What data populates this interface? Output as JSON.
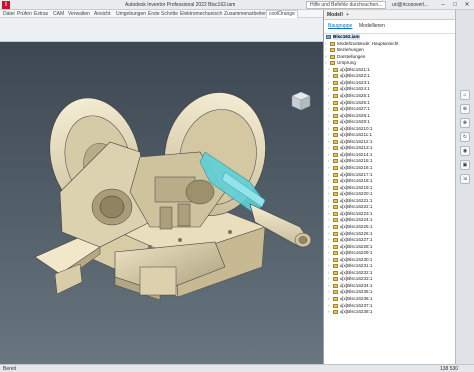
{
  "window": {
    "title": "Autodesk Inventor Professional 2022   Blsc162.iam",
    "help_search": "Hilfe und Befehle durchsuchen...",
    "user": "uri@ricosoverl...",
    "controls": {
      "minimize": "–",
      "maximize": "□",
      "close": "✕"
    }
  },
  "ribbon": {
    "tabs": [
      "Datei",
      "Prüfen",
      "Extras",
      "CAM",
      "Verwalten",
      "Ansicht",
      "Umgebungen",
      "Erste Schritte",
      "Elektromechanisch",
      "Zusammenarbeiten",
      "coolOrange"
    ],
    "active_tab": "coolOrange"
  },
  "browser": {
    "tabs": [
      "Modell",
      "+"
    ],
    "toolbar_primary": "Baugruppe",
    "toolbar_secondary": "Modellieren",
    "tree": [
      {
        "label": "Blsc162.iam",
        "type": "assembly",
        "selected": true
      },
      {
        "label": "Modellzustände: Hauptansicht",
        "type": "folder"
      },
      {
        "label": "Beziehungen",
        "type": "folder"
      },
      {
        "label": "Darstellungen",
        "type": "folder"
      },
      {
        "label": "Ursprung",
        "type": "folder"
      },
      {
        "label": "ᴀ[x]Blsc1621:1",
        "type": "part"
      },
      {
        "label": "ᴀ[x]Blsc1622:1",
        "type": "part"
      },
      {
        "label": "ᴀ[x]Blsc1623:1",
        "type": "part"
      },
      {
        "label": "ᴀ[x]Blsc1624:1",
        "type": "part"
      },
      {
        "label": "ᴀ[x]Blsc1625:1",
        "type": "part"
      },
      {
        "label": "ᴀ[x]Blsc1626:1",
        "type": "part"
      },
      {
        "label": "ᴀ[x]Blsc1627:1",
        "type": "part"
      },
      {
        "label": "ᴀ[x]Blsc1628:1",
        "type": "part"
      },
      {
        "label": "ᴀ[x]Blsc1629:1",
        "type": "part"
      },
      {
        "label": "ᴀ[x]Blsc16210:1",
        "type": "part"
      },
      {
        "label": "ᴀ[x]Blsc16211:1",
        "type": "part"
      },
      {
        "label": "ᴀ[x]Blsc16212:1",
        "type": "part"
      },
      {
        "label": "ᴀ[x]Blsc16213:1",
        "type": "part"
      },
      {
        "label": "ᴀ[x]Blsc16214:1",
        "type": "part"
      },
      {
        "label": "ᴀ[x]Blsc16215:1",
        "type": "part"
      },
      {
        "label": "ᴀ[x]Blsc16216:1",
        "type": "part"
      },
      {
        "label": "ᴀ[x]Blsc16217:1",
        "type": "part"
      },
      {
        "label": "ᴀ[x]Blsc16218:1",
        "type": "part"
      },
      {
        "label": "ᴀ[x]Blsc16219:1",
        "type": "part"
      },
      {
        "label": "ᴀ[x]Blsc16220:1",
        "type": "part"
      },
      {
        "label": "ᴀ[x]Blsc16221:1",
        "type": "part"
      },
      {
        "label": "ᴀ[x]Blsc16222:1",
        "type": "part"
      },
      {
        "label": "ᴀ[x]Blsc16223:1",
        "type": "part"
      },
      {
        "label": "ᴀ[x]Blsc16224:1",
        "type": "part"
      },
      {
        "label": "ᴀ[x]Blsc16225:1",
        "type": "part"
      },
      {
        "label": "ᴀ[x]Blsc16226:1",
        "type": "part"
      },
      {
        "label": "ᴀ[x]Blsc16227:1",
        "type": "part"
      },
      {
        "label": "ᴀ[x]Blsc16228:1",
        "type": "part"
      },
      {
        "label": "ᴀ[x]Blsc16229:1",
        "type": "part"
      },
      {
        "label": "ᴀ[x]Blsc16230:1",
        "type": "part"
      },
      {
        "label": "ᴀ[x]Blsc16231:1",
        "type": "part"
      },
      {
        "label": "ᴀ[x]Blsc16232:1",
        "type": "part"
      },
      {
        "label": "ᴀ[x]Blsc16233:1",
        "type": "part"
      },
      {
        "label": "ᴀ[x]Blsc16234:1",
        "type": "part"
      },
      {
        "label": "ᴀ[x]Blsc16235:1",
        "type": "part"
      },
      {
        "label": "ᴀ[x]Blsc16236:1",
        "type": "part"
      },
      {
        "label": "ᴀ[x]Blsc16237:1",
        "type": "part"
      },
      {
        "label": "ᴀ[x]Blsc16238:1",
        "type": "part"
      }
    ]
  },
  "nav_bar": {
    "icons": [
      "home-icon",
      "zoom-icon",
      "pan-icon",
      "orbit-icon",
      "look-icon",
      "fit-icon",
      "walk-icon"
    ]
  },
  "status": {
    "left": "Bereit",
    "counts": [
      "138",
      "530"
    ]
  },
  "colors": {
    "accent": "#0b6fc2",
    "highlight": "#5fd0d8",
    "part": "#ece2c1"
  }
}
